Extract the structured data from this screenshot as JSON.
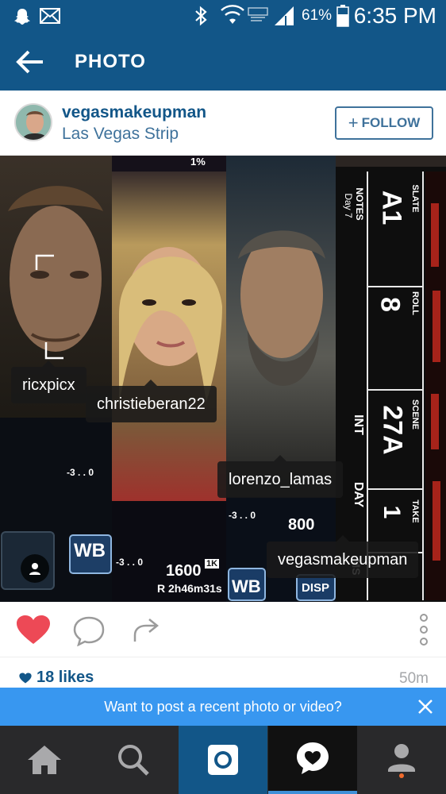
{
  "status_bar": {
    "battery_percent": "61%",
    "time": "6:35 PM",
    "icons": [
      "snapchat-ghost-icon",
      "mail-icon",
      "bluetooth-icon",
      "wifi-icon",
      "data-icon",
      "signal-icon",
      "battery-icon"
    ]
  },
  "header": {
    "title": "PHOTO",
    "back_icon": "back-arrow-icon"
  },
  "post": {
    "username": "vegasmakeupman",
    "location": "Las Vegas Strip",
    "follow_label": "FOLLOW",
    "follow_icon": "+",
    "tags": [
      {
        "label": "ricxpicx"
      },
      {
        "label": "christieberan22"
      },
      {
        "label": "lorenzo_lamas"
      },
      {
        "label": "vegasmakeupman"
      }
    ],
    "photo_text": {
      "panel2_status": "1%",
      "panel1_meter": "-3 . . 0",
      "panel1_wb": "WB",
      "panel2_meter": "-3 . . 0",
      "panel2_iso": "1600",
      "panel2_iso_badge": "1K",
      "panel2_remaining": "R 2h46m31s",
      "panel3_meter": "-3 . . 0",
      "panel3_iso": "800",
      "panel3_wb": "WB",
      "panel3_disp": "DISP",
      "slate_notes": "NOTES",
      "slate_day7": "Day 7",
      "slate_label": "SLATE",
      "slate_value": "A1",
      "roll_label": "ROLL",
      "roll_value": "8",
      "scene_label": "SCENE",
      "scene_value": "27A",
      "int_label": "INT",
      "day_label": "DAY",
      "take_label": "TAKE",
      "take_value": "1",
      "ms_label": "MS"
    },
    "likes": "18 likes",
    "time_ago": "50m"
  },
  "banner": {
    "text": "Want to post a recent photo or video?"
  },
  "tabbar": {
    "tabs": [
      "home-icon",
      "search-icon",
      "camera-icon",
      "activity-icon",
      "profile-icon"
    ]
  },
  "colors": {
    "brand_blue": "#125688",
    "link_blue": "#3f729b",
    "banner_blue": "#3897f0",
    "heart_red": "#ed4956",
    "tabbar_dark": "#29292b"
  }
}
